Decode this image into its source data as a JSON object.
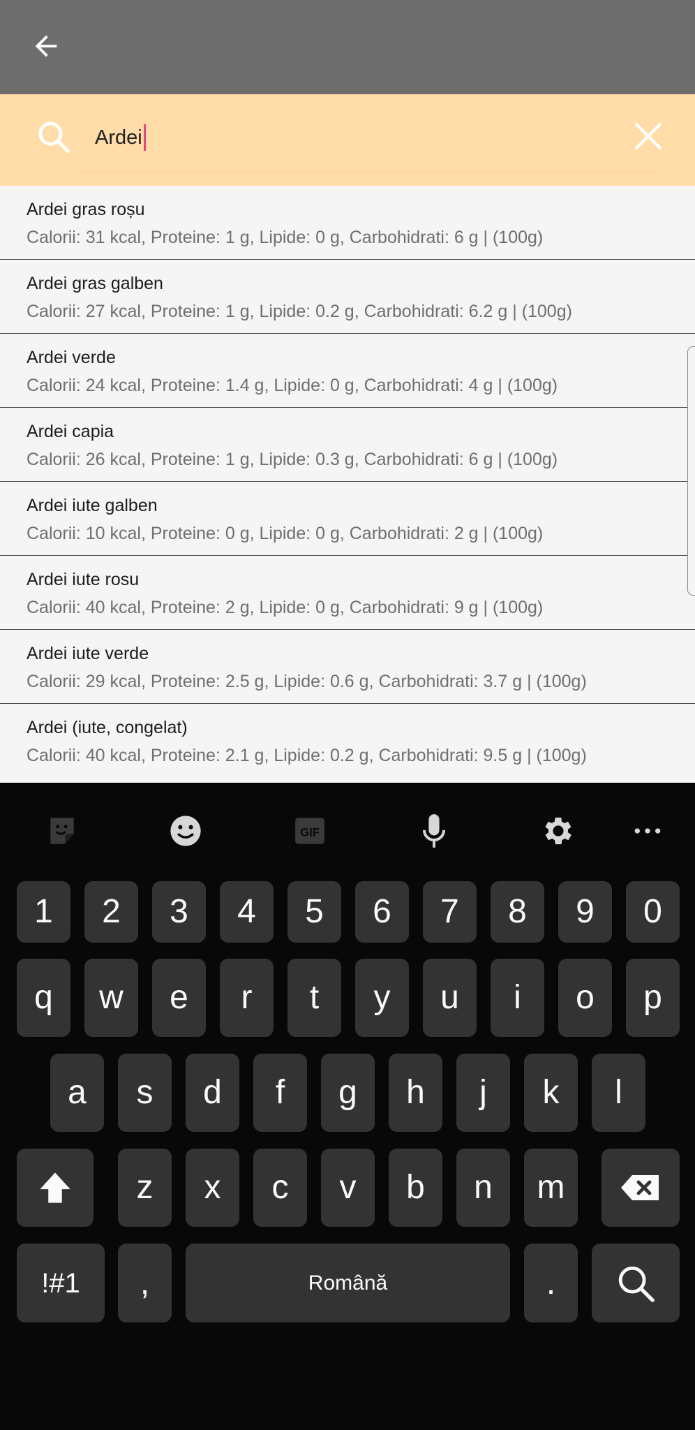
{
  "search": {
    "query": "Ardei"
  },
  "results": [
    {
      "title": "Ardei gras roșu",
      "details": "Calorii: 31 kcal, Proteine: 1 g, Lipide: 0 g, Carbohidrati: 6 g | (100g)"
    },
    {
      "title": "Ardei gras galben",
      "details": "Calorii: 27 kcal, Proteine: 1 g, Lipide: 0.2 g, Carbohidrati: 6.2 g | (100g)"
    },
    {
      "title": "Ardei verde",
      "details": "Calorii: 24 kcal, Proteine: 1.4 g, Lipide: 0 g, Carbohidrati: 4 g | (100g)"
    },
    {
      "title": "Ardei capia",
      "details": "Calorii: 26 kcal, Proteine: 1 g, Lipide: 0.3 g, Carbohidrati: 6 g | (100g)"
    },
    {
      "title": "Ardei iute galben",
      "details": "Calorii: 10 kcal, Proteine: 0 g, Lipide: 0 g, Carbohidrati: 2 g | (100g)"
    },
    {
      "title": "Ardei iute rosu",
      "details": "Calorii: 40 kcal, Proteine: 2 g, Lipide: 0 g, Carbohidrati: 9 g | (100g)"
    },
    {
      "title": "Ardei iute verde",
      "details": "Calorii: 29 kcal, Proteine: 2.5 g, Lipide: 0.6 g, Carbohidrati: 3.7 g | (100g)"
    },
    {
      "title": "Ardei (iute, congelat)",
      "details": "Calorii: 40 kcal, Proteine: 2.1 g, Lipide: 0.2 g, Carbohidrati: 9.5 g | (100g)"
    }
  ],
  "keyboard": {
    "toolbar": {
      "gif_label": "GIF",
      "icons": [
        "sticker-icon",
        "emoji-icon",
        "gif-icon",
        "microphone-icon",
        "settings-icon",
        "more-icon"
      ]
    },
    "row_numbers": [
      "1",
      "2",
      "3",
      "4",
      "5",
      "6",
      "7",
      "8",
      "9",
      "0"
    ],
    "row_top": [
      "q",
      "w",
      "e",
      "r",
      "t",
      "y",
      "u",
      "i",
      "o",
      "p"
    ],
    "row_home": [
      "a",
      "s",
      "d",
      "f",
      "g",
      "h",
      "j",
      "k",
      "l"
    ],
    "row_bottom": [
      "z",
      "x",
      "c",
      "v",
      "b",
      "n",
      "m"
    ],
    "symbols_label": "!#1",
    "comma_label": ",",
    "space_label": "Română",
    "period_label": "."
  },
  "colors": {
    "app_bar": "#6e6e6e",
    "search_bar": "#ffdca8",
    "caret": "#e8467c",
    "keyboard_bg": "#080808",
    "key_bg": "#333333"
  }
}
